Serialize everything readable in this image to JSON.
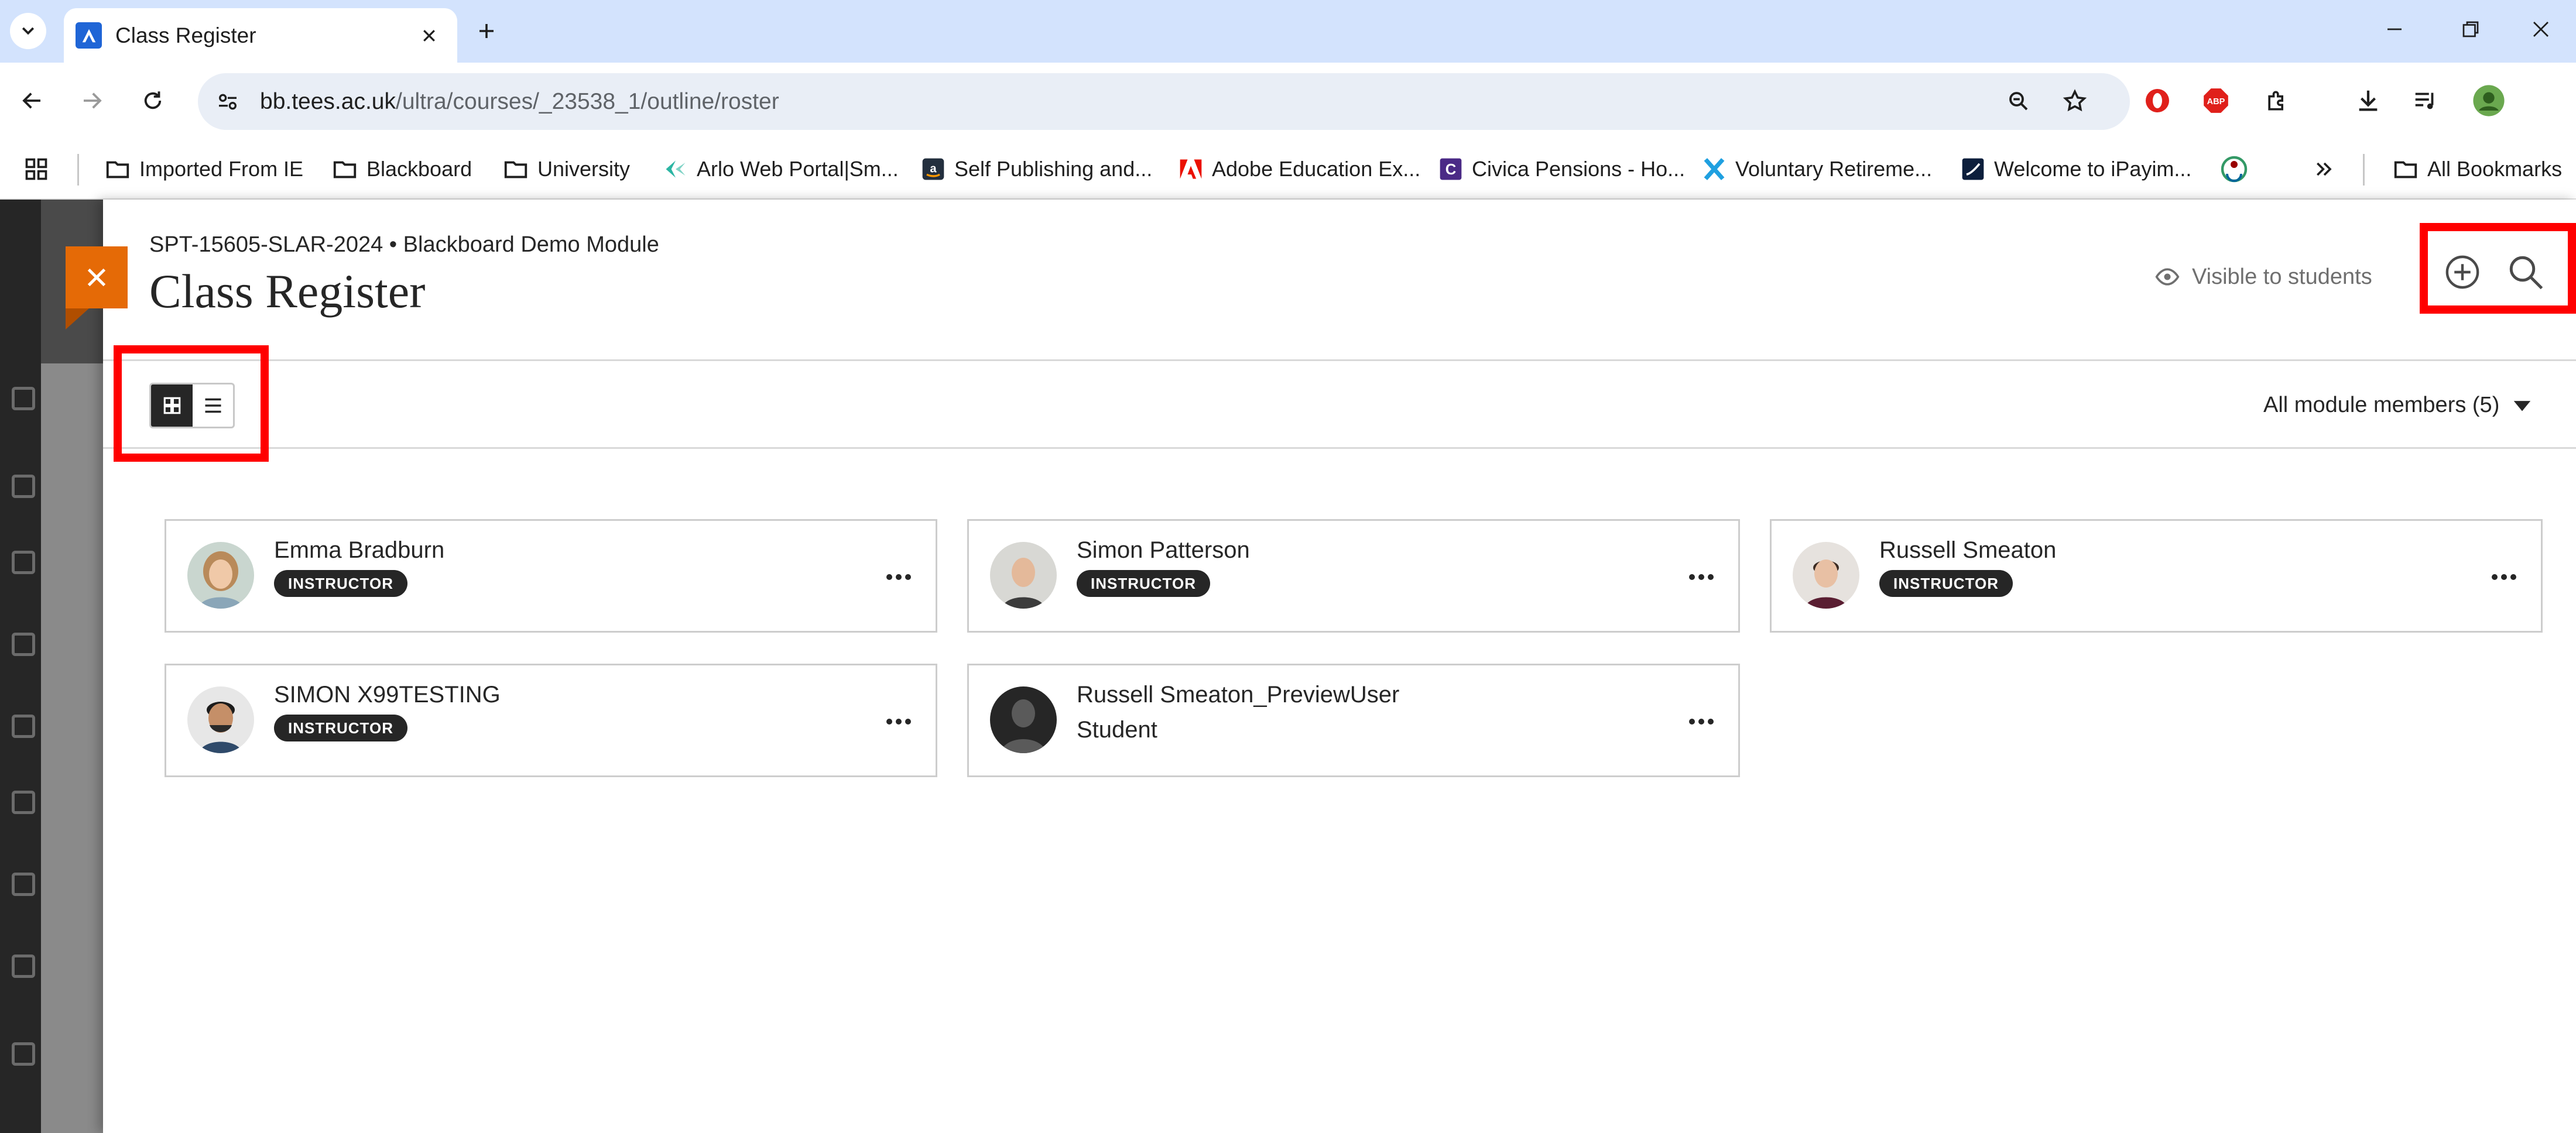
{
  "browser": {
    "tab_title": "Class Register",
    "url_host": "bb.tees.ac.uk",
    "url_path": "/ultra/courses/_23538_1/outline/roster",
    "bookmarks": [
      "Imported From IE",
      "Blackboard",
      "University",
      "Arlo Web Portal|Sm...",
      "Self Publishing and...",
      "Adobe Education Ex...",
      "Civica Pensions - Ho...",
      "Voluntary Retireme...",
      "Welcome to iPayim..."
    ],
    "all_bookmarks": "All Bookmarks"
  },
  "panel": {
    "breadcrumb": "SPT-15605-SLAR-2024 • Blackboard Demo Module",
    "title": "Class Register",
    "visibility": "Visible to students",
    "filter": "All module members (5)"
  },
  "members": [
    {
      "name": "Emma Bradburn",
      "role": "INSTRUCTOR"
    },
    {
      "name": "Simon Patterson",
      "role": "INSTRUCTOR"
    },
    {
      "name": "Russell Smeaton",
      "role": "INSTRUCTOR"
    },
    {
      "name": "SIMON X99TESTING",
      "role": "INSTRUCTOR"
    },
    {
      "name": "Russell Smeaton_PreviewUser",
      "role": "Student"
    }
  ],
  "colors": {
    "accent_close": "#e56a06",
    "highlight": "#ff0000",
    "tab_strip": "#d3e3fd"
  }
}
